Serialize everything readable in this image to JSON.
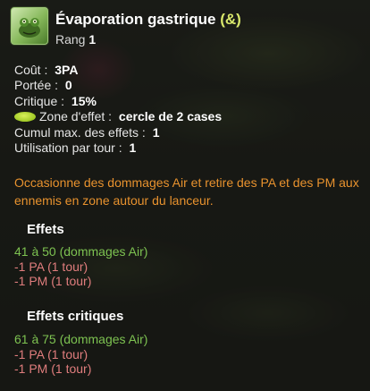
{
  "spell": {
    "icon": "frog-spell-icon",
    "name": "Évaporation gastrique",
    "tag": "(&)",
    "rank_label": "Rang",
    "rank_value": "1"
  },
  "stats": {
    "cout_label": "Coût :",
    "cout_value": "3PA",
    "portee_label": "Portée :",
    "portee_value": "0",
    "critique_label": "Critique :",
    "critique_value": "15%",
    "zone_label": "Zone d'effet :",
    "zone_value": "cercle de 2 cases",
    "cumul_label": "Cumul max. des effets :",
    "cumul_value": "1",
    "utilisation_label": "Utilisation par tour :",
    "utilisation_value": "1"
  },
  "description": "Occasionne des dommages Air et retire des PA et des PM aux ennemis en zone autour du lanceur.",
  "effects": {
    "title": "Effets",
    "lines": [
      "41 à 50 (dommages Air)",
      "-1 PA (1 tour)",
      "-1 PM (1 tour)"
    ]
  },
  "critical_effects": {
    "title": "Effets critiques",
    "lines": [
      "61 à 75 (dommages Air)",
      "-1 PA (1 tour)",
      "-1 PM (1 tour)"
    ]
  },
  "colors": {
    "title": "#ffffff",
    "tag": "#d9e86b",
    "description": "#e8922e",
    "damage": "#7dc251",
    "malus": "#e07d7d"
  }
}
